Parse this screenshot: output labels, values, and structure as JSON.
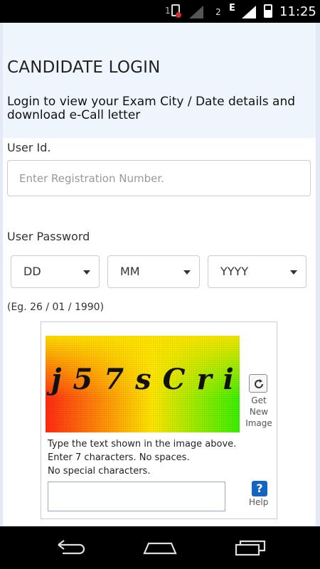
{
  "status_bar": {
    "sim1_label": "1",
    "sim2_label": "2",
    "network_type": "E",
    "time": "11:25"
  },
  "header": {
    "title": "CANDIDATE LOGIN",
    "subtitle": "Login to view your Exam City / Date details and download e-Call letter"
  },
  "login_form": {
    "user_id_label": "User Id.",
    "user_id_placeholder": "Enter Registration Number.",
    "user_id_value": "",
    "password_label": "User Password",
    "day_select": "DD",
    "month_select": "MM",
    "year_select": "YYYY",
    "date_example": "(Eg. 26 / 01 / 1990)"
  },
  "captcha": {
    "image_text": "j57sCri",
    "refresh_label_line1": "Get",
    "refresh_label_line2": "New",
    "refresh_label_line3": "Image",
    "instruction_line1": "Type the text shown in the image above.",
    "instruction_line2": "Enter 7 characters. No spaces.",
    "instruction_line3": "No special characters.",
    "input_value": "",
    "help_symbol": "?",
    "help_label": "Help"
  },
  "colors": {
    "header_bg": "#eef5fd",
    "help_icon": "#1565c0",
    "page_side": "#e3eaf6"
  },
  "nav_bar": {
    "icons": [
      "back-icon",
      "home-icon",
      "recents-icon"
    ]
  }
}
